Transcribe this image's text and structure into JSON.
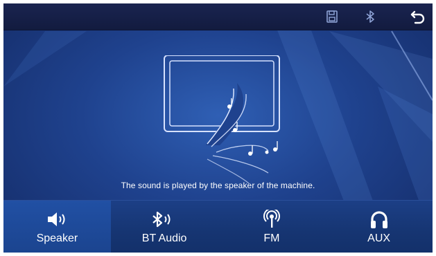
{
  "topbar": {
    "icons": [
      "save-icon",
      "bluetooth-icon",
      "back-icon"
    ]
  },
  "main": {
    "message": "The sound is played by the speaker of the machine."
  },
  "sources": [
    {
      "label": "Speaker",
      "icon": "speaker-icon",
      "active": true
    },
    {
      "label": "BT Audio",
      "icon": "bluetooth-audio-icon",
      "active": false
    },
    {
      "label": "FM",
      "icon": "radio-icon",
      "active": false
    },
    {
      "label": "AUX",
      "icon": "headphones-icon",
      "active": false
    }
  ],
  "colors": {
    "background": "#1f428e",
    "topbar": "#151e46",
    "text": "#ffffff",
    "icon_muted": "#8ea3d6"
  }
}
